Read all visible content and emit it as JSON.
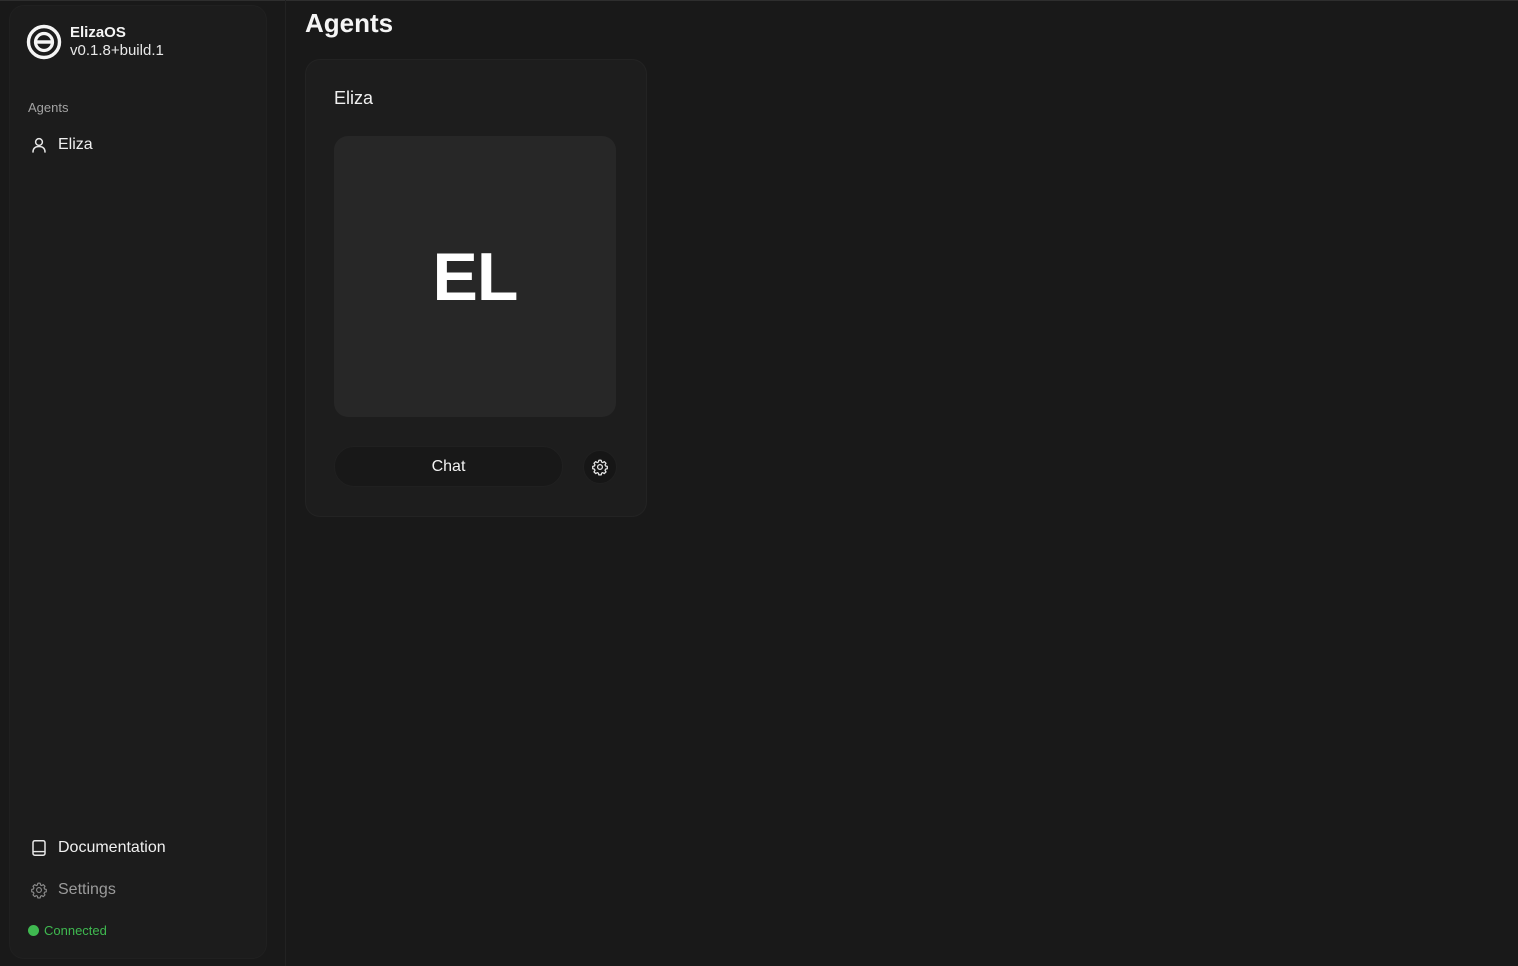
{
  "brand": {
    "name": "ElizaOS",
    "version": "v0.1.8+build.1",
    "logo_icon": "eliza-logo-icon"
  },
  "sidebar": {
    "section_label": "Agents",
    "agents": [
      {
        "label": "Eliza",
        "icon": "user-icon"
      }
    ],
    "footer": {
      "documentation_label": "Documentation",
      "documentation_icon": "book-icon",
      "settings_label": "Settings",
      "settings_icon": "gear-icon"
    },
    "status": {
      "text": "Connected",
      "color": "#3fb950"
    }
  },
  "main": {
    "title": "Agents",
    "cards": [
      {
        "name": "Eliza",
        "initials": "EL",
        "chat_label": "Chat",
        "settings_icon": "gear-icon"
      }
    ]
  },
  "colors": {
    "background": "#191919",
    "sidebar": "#1c1c1c",
    "card": "#1d1d1d",
    "avatar": "#272727",
    "status_green": "#3fb950"
  }
}
